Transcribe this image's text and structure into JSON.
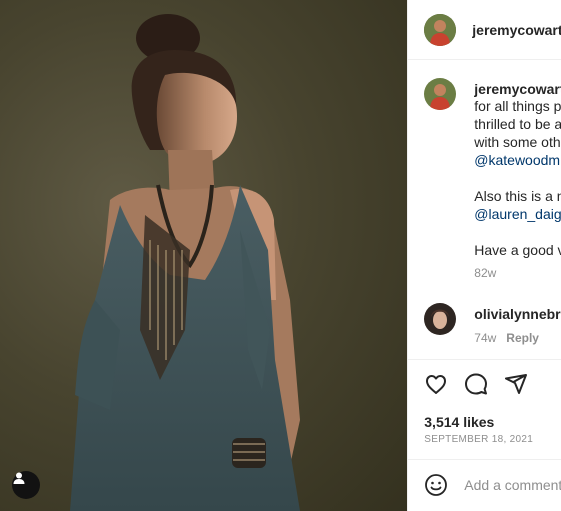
{
  "post": {
    "author": "jeremycowart",
    "photo_alt": "Portrait of a woman in a flowing blue-gray dress with a beaded necklace"
  },
  "caption": {
    "username": "jeremycowart",
    "lines": [
      "for all things p",
      "thrilled to be a",
      "with some oth"
    ],
    "mention_1": "@katewoodm",
    "line_5": "Also this is a n",
    "mention_2": "@lauren_daig",
    "line_7": "Have a good v",
    "age": "82w"
  },
  "comment": {
    "username": "olivialynnebro",
    "age": "74w",
    "reply_label": "Reply"
  },
  "actions": {
    "likes": "3,514 likes",
    "date": "SEPTEMBER 18, 2021"
  },
  "composer": {
    "placeholder": "Add a comment"
  }
}
